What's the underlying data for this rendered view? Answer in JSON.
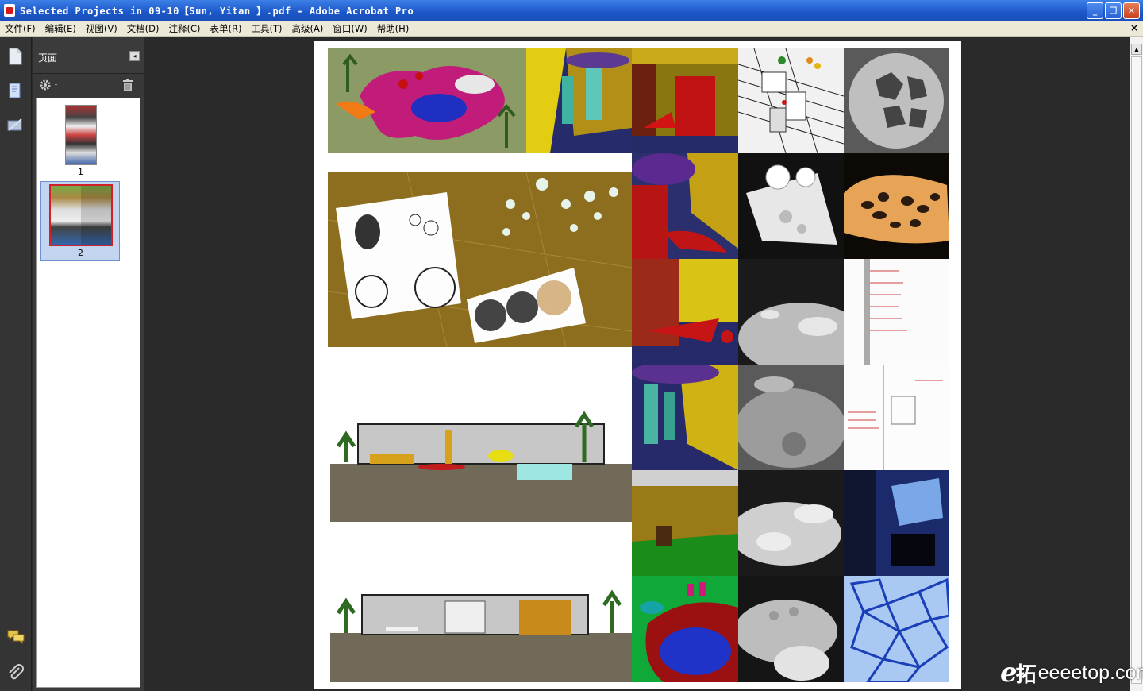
{
  "window": {
    "title": "Selected Projects in 09-10【Sun, Yitan 】.pdf - Adobe Acrobat Pro",
    "minimize": "_",
    "maximize": "❐",
    "close": "✕"
  },
  "menu": {
    "items": [
      "文件(F)",
      "编辑(E)",
      "视图(V)",
      "文档(D)",
      "注释(C)",
      "表单(R)",
      "工具(T)",
      "高级(A)",
      "窗口(W)",
      "帮助(H)"
    ],
    "close": "×"
  },
  "panel": {
    "title": "页面",
    "collapse": "◂",
    "pages": [
      "1",
      "2"
    ]
  },
  "watermark": {
    "logo": "e",
    "cn": "拓",
    "site": "eeeetop.com"
  },
  "colors": {
    "titlebar": "#1b57c9",
    "selection": "#c3d4ef",
    "thumb_border": "#d0212a"
  }
}
